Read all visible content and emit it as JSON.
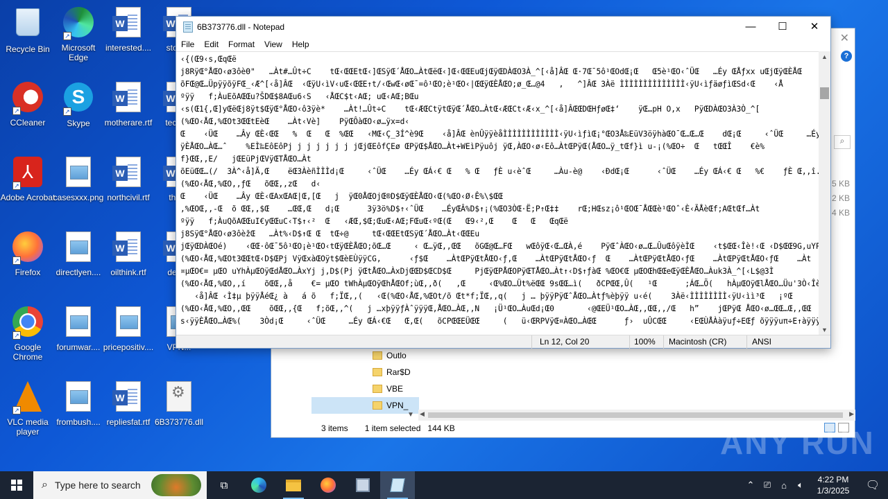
{
  "desktop": {
    "icons": [
      {
        "label": "Recycle Bin",
        "type": "recycle"
      },
      {
        "label": "Microsoft Edge",
        "type": "edge"
      },
      {
        "label": "interested....",
        "type": "word"
      },
      {
        "label": "store...",
        "type": "word"
      },
      {
        "label": "CCleaner",
        "type": "ccleaner"
      },
      {
        "label": "Skype",
        "type": "skype"
      },
      {
        "label": "motherare.rtf",
        "type": "word"
      },
      {
        "label": "techn...",
        "type": "word"
      },
      {
        "label": "Adobe Acrobat",
        "type": "acrobat"
      },
      {
        "label": "casesxxx.png",
        "type": "png"
      },
      {
        "label": "northcivil.rtf",
        "type": "word"
      },
      {
        "label": "thin...",
        "type": "word"
      },
      {
        "label": "Firefox",
        "type": "firefox"
      },
      {
        "label": "directlyen....",
        "type": "png"
      },
      {
        "label": "oilthink.rtf",
        "type": "word"
      },
      {
        "label": "dete...",
        "type": "word"
      },
      {
        "label": "Google Chrome",
        "type": "chrome"
      },
      {
        "label": "forumwar....",
        "type": "png"
      },
      {
        "label": "pricepositiv....",
        "type": "png"
      },
      {
        "label": "VPN...",
        "type": "png"
      },
      {
        "label": "VLC media player",
        "type": "vlc"
      },
      {
        "label": "frombush....",
        "type": "png"
      },
      {
        "label": "repliesfat.rtf",
        "type": "word"
      },
      {
        "label": "6B373776.dll",
        "type": "dll"
      }
    ]
  },
  "explorer": {
    "folders": [
      {
        "label": "Outlo",
        "selected": false
      },
      {
        "label": "Rar$D",
        "selected": false
      },
      {
        "label": "VBE",
        "selected": false
      },
      {
        "label": "VPN_",
        "selected": true
      }
    ],
    "status": {
      "items": "3 items",
      "selected": "1 item selected",
      "size": "144 KB"
    },
    "sizes": [
      "5 KB",
      "2 KB",
      "4 KB"
    ]
  },
  "notepad": {
    "title": "6B373776.dll - Notepad",
    "menu": [
      "File",
      "Edit",
      "Format",
      "View",
      "Help"
    ],
    "content_lines": [
      "‹{(Œ9‹s,ŒqŒë",
      "j8RÿŒ°ÅŒO‹ø3ôèΘ\"   …Àt#…Ût÷C    tŒ‹ŒŒEtŒ‹]ŒSÿŒ´ÅŒO…ÀtŒëŒ‹]Œ‹ŒŒEuŒjŒÿŒDÀŒO3À_^[‹å]ÂŒ Œ·7Œ¯5ô¹ŒOdŒ¡Œ   Œ5è¹ŒO‹ˆÜŒ   …Éy ŒÅƒxx uŒjŒÿŒÈÅŒ",
      "õFŒ@Œ…ÜpÿÿõÿFŒ_‹Æ^[‹å]ÂŒ  ‹ŒÿU‹ìV‹uŒ‹ŒŒE↑t/‹ŒwŒ‹øŒ¯=ô¹ŒO;è¹ŒO‹|ŒŒÿŒÈÅŒO;ø_Œ…@4   ‚   ^]ÂŒ 3Àë ÌÌÌÌÌÌÌÌÌÌÌÌÌÌ‹ÿU‹ìƒäøƒìŒSd‹Œ    ‹Å",
      "ºÿÿ   f;ÀuEõAŒŒu?ŠDŒ$8AŒu6‹S   ‹ÅŒC$t‹AŒ; uŒ‹AŒ;BŒu",
      "‹s(Œ1{,Œ]yŒëŒj8ÿt$ŒÿŒ°ÅŒO‹ô3ÿè*    …Àt!…Ût÷C    tŒ‹ÆŒCtÿtŒÿŒ´ÅŒO…ÀtŒ‹ÆŒCt‹Æ‹x_^[‹å]ÂŒŒDŒHƒøŒ‡‘    ÿŒ…pH O,x   PÿŒDÀŒO3À3Ò_^[",
      "(%ŒO‹ÅŒ,%ŒOt3ŒŒtEèŒ    …Àt‹Vè]    PÿŒÔàŒO‹ø…ÿx=d‹",
      "Œ    ‹ÜŒ    …Ây ŒÈ‹ŒŒ   %  Œ   Œ  %ŒŒ   ‹MŒ‹Ç_3Í^è9Œ    ‹å]ÂŒ ènÛÿÿèåÌÌÌÌÌÌÌÌÌÌÌÌ‹ÿU‹ìƒìŒ¡°ŒO3Å‰EüV3öÿhàŒO¯Œ…Œ…Œ    dŒ¡Œ     ‹ˆÜŒ     …Éy",
      "ÿÈÅŒO…ÀŒ…ˆ    %EÌ‰EôEôPj j j j j j j jŒjŒEôfÇEø ŒPÿŒ$ÅŒO…Àt+WEìPÿuôj ÿŒ,ÀŒO‹ø‹Eô…ÀtŒPÿŒ(ÅŒO…ÿ_tŒf}ì u-¡(%ŒO÷  Œ   tŒŒÎ    €è%",
      "f}ŒŒ,,E/   jŒEüPjŒVÿŒTÅŒO…Àt",
      "õEüŒŒ…(/  3À^‹å]Ã,Œ    ëŒ3ÀèñÌÌÌd¡Œ     ‹ˆÜŒ    …Éy ŒÁ‹€ Œ   % Œ   ƒÈ u‹èˆŒ     …Àu-è@    ‹ÐdŒ¡Œ      ‹ˆÜŒ    …Éy ŒÁ‹€ Œ   %€    ƒÈ Œ,,î.    Œ",
      "(%ŒO‹ÅŒ,%ŒO,,ƒŒ   õŒŒ,,zŒ   d‹",
      "Œ    ‹ÜŒ    …Ây ŒÈ‹ŒAxŒAŒ|Œ,[Œ   j  ÿŒ0ÅŒOjŒ®D$ŒÿŒÈÅŒO‹Œ(%ŒO‹Ø‹Ê%\\$ŒŒ",
      ",%ŒOŒ,,-Œ  õ ŒŒ,,$Œ    …ŒŒ,Œ   d¡Œ      3ÿ3ö%D$↑‹ˆÜŒ    …ÉyŒÂ%D$↑¡(%ŒO3ÒŒ·Ë;P↑Œ‡‡    rŒ;HŒsz¡ô¹ŒOŒ¯ÅŒŒè¹ŒOˆ‹È‹ÃÅèŒf;AŒtŒf…Àt",
      "ºÿÿ   f;ÀuQõAŒŒuI€yŒŒuC‹T$↑‹²  Œ   ‹ÆŒ,$Œ;ŒuŒ‹AŒ;FŒuŒ‹ºŒ(Œ   Œ9‹²,Œ    Œ   Œ   ŒqŒë",
      "j8SÿŒ°ÅŒO‹ø3ôèžŒ   …Àt%‹D$↑Œ Œ  tŒ÷@     tŒ‹ŒŒEtŒSÿŒ´ÅŒO…Àt‹ŒŒEu",
      "jŒÿŒDÀŒOé)    ‹ŒŒ·ôŒ¯5ô¹ŒO¡è¹ŒO‹tŒÿŒÈÅŒO;õŒ…Œ     ‹ Œ…ÿŒ,,ŒŒ   õGŒ@Œ…FŒ   wŒôÿŒ‹Œ…ŒÀ,é    PÿŒˆÀŒO‹ø…Œ…ÛuŒôÿèÌŒ    ‹t$ŒŒ‹Îè!‹Œ ‹D$ŒŒ9G,uYPèß÷ÿÿ%",
      "(%ŒO‹ÅŒ,%ŒOt3ŒŒtŒ‹D$ŒPj VÿŒxàŒOÿt$ŒèEÙÿÿCG,      ‹ƒ$Œ    …ÀtŒPÿŒtÅŒO‹ƒ,Œ    …ÀtŒPÿŒtÅŒO‹ƒ  Œ    …ÀtŒPÿŒtÅŒO‹ƒŒ    …ÀtŒPÿŒtÅŒO‹ƒŒ    …Àt",
      "¤µŒO€= µŒO uYhÀµŒOÿŒdÅŒO…ÀxYj j,D$(Pj ÿŒtÅŒO…ÀxDjŒŒD$ŒCD$Œ     PjŒÿŒPÅŒOPÿŒTÅŒO…Àt↑‹D$↑ƒàŒ %ŒO€Œ µŒOŒhŒŒeŒÿŒÈÅŒO…Àuk3À_^[‹L$@3Ì",
      "(%ŒO‹ÅŒ,%ŒO,,í    õŒŒ,,å    €= µŒO tWhÀµŒOÿŒhÅŒOf;ùŒ,,ð(   ,Œ     ‹Œ%ŒO…Üt%ëŒŒ 9sŒŒ…ì(   ðCPŒŒ,Û(   ¹Œ      ;ÁŒ…Õ(   hÀµŒOÿŒlÅŒO…Üu'3Ò‹Îè¨",
      "   ‹å]ÂŒ ‹Ì‡µ þÿÿÅéŒ¿ à   á õ   f;ÏŒ,,(   ‹Œ(%ŒO‹ÅŒ,%ŒOt/õ Œt*f;ÏŒ,,q(   j … þÿÿPÿŒˆÅŒO…Àtƒ%èþÿÿ u‹é(    3Àë‹ÌÌÌÌÌÌÌÌ‹ÿU‹ìì³Œ   ¡ºŒ",
      "(%ŒO‹ÅŒ,%ŒO,,ŒŒ    õŒŒ,,{Œ   f;õŒ,,^(   j …xþÿÿƒÀˆÿÿÿŒ,ÅŒO…ÀŒ,,N   ¡Ü¹ŒO…ÀuŒd¡Œ0       ‹@ŒEÜ¹ŒO…ÀŒ,,ŒŒ,,/Œ   h”    jŒPÿŒ ÅŒO‹ø…ŒŒ…Œ,,ŒŒ    h Œ",
      "s‹ÿÿÈÅŒO…ÀŒ%(    3Òd¡Œ     ‹ˆÜŒ     …Éy ŒÁ‹€Œ   Œ,Œ(   õCPŒŒEÜŒŒ     (   ü‹ŒRPVÿŒ¤ÀŒO…ÀŒŒ      ƒ›  uÛCŒŒ     ‹EŒÙÅÀàÿuƒ÷EŒƒ õÿÿÿuπ÷E↑àÿÿÿÿui÷EŒ"
    ],
    "status": {
      "position": "Ln 12, Col 20",
      "zoom": "100%",
      "eol": "Macintosh (CR)",
      "encoding": "ANSI"
    }
  },
  "taskbar": {
    "search_placeholder": "Type here to search",
    "apps": [
      "task-view",
      "edge",
      "file-explorer",
      "firefox",
      "installer",
      "notepad"
    ],
    "clock_time": "4:22 PM",
    "clock_date": "1/3/2025"
  },
  "watermark": "ANY RUN"
}
